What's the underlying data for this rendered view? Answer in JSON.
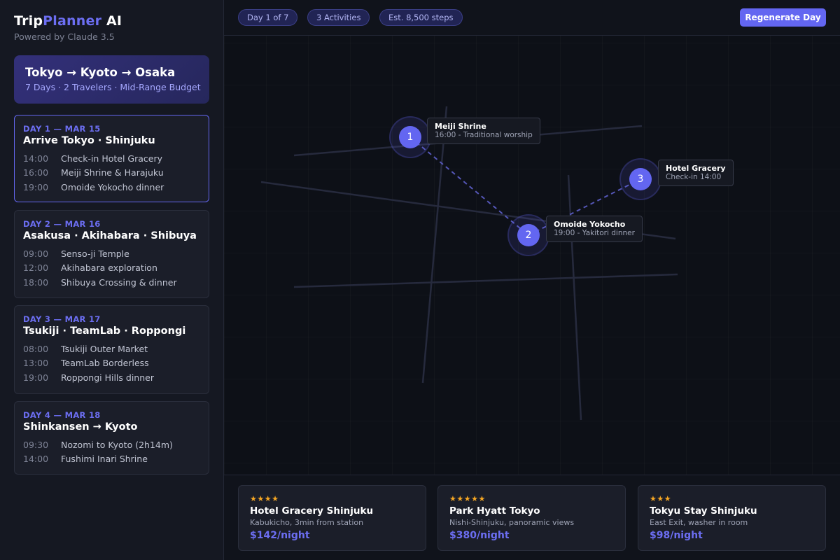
{
  "app": {
    "brand_main": "Trip",
    "brand_accent": "Planner",
    "brand_suffix": " AI",
    "powered_by": "Powered by Claude 3.5"
  },
  "trip": {
    "route": "Tokyo → Kyoto → Osaka",
    "summary": "7 Days · 2 Travelers · Mid-Range Budget"
  },
  "days": [
    {
      "header": "DAY 1 — MAR 15",
      "title": "Arrive Tokyo · Shinjuku",
      "active": true,
      "activities": [
        {
          "time": "14:00",
          "label": "Check-in Hotel Gracery"
        },
        {
          "time": "16:00",
          "label": "Meiji Shrine & Harajuku"
        },
        {
          "time": "19:00",
          "label": "Omoide Yokocho dinner"
        }
      ]
    },
    {
      "header": "DAY 2 — MAR 16",
      "title": "Asakusa · Akihabara · Shibuya",
      "active": false,
      "activities": [
        {
          "time": "09:00",
          "label": "Senso-ji Temple"
        },
        {
          "time": "12:00",
          "label": "Akihabara exploration"
        },
        {
          "time": "18:00",
          "label": "Shibuya Crossing & dinner"
        }
      ]
    },
    {
      "header": "DAY 3 — MAR 17",
      "title": "Tsukiji · TeamLab · Roppongi",
      "active": false,
      "activities": [
        {
          "time": "08:00",
          "label": "Tsukiji Outer Market"
        },
        {
          "time": "13:00",
          "label": "TeamLab Borderless"
        },
        {
          "time": "19:00",
          "label": "Roppongi Hills dinner"
        }
      ]
    },
    {
      "header": "DAY 4 — MAR 18",
      "title": "Shinkansen → Kyoto",
      "active": false,
      "activities": [
        {
          "time": "09:30",
          "label": "Nozomi to Kyoto (2h14m)"
        },
        {
          "time": "14:00",
          "label": "Fushimi Inari Shrine"
        }
      ]
    }
  ],
  "topbar": {
    "pills": [
      "Day 1 of 7",
      "3 Activities",
      "Est. 8,500 steps"
    ],
    "regenerate_label": "Regenerate Day"
  },
  "map": {
    "markers": [
      {
        "number": "1",
        "name": "Meiji Shrine",
        "detail": "16:00 - Traditional worship"
      },
      {
        "number": "2",
        "name": "Omoide Yokocho",
        "detail": "19:00 - Yakitori dinner"
      },
      {
        "number": "3",
        "name": "Hotel Gracery",
        "detail": "Check-in 14:00"
      }
    ]
  },
  "hotels": [
    {
      "stars": "★★★★",
      "name": "Hotel Gracery Shinjuku",
      "description": "Kabukicho, 3min from station",
      "price": "$142/night"
    },
    {
      "stars": "★★★★★",
      "name": "Park Hyatt Tokyo",
      "description": "Nishi-Shinjuku, panoramic views",
      "price": "$380/night"
    },
    {
      "stars": "★★★",
      "name": "Tokyu Stay Shinjuku",
      "description": "East Exit, washer in room",
      "price": "$98/night"
    }
  ],
  "colors": {
    "accent": "#6366f1",
    "star": "#f5a623",
    "background": "#0f1118"
  }
}
